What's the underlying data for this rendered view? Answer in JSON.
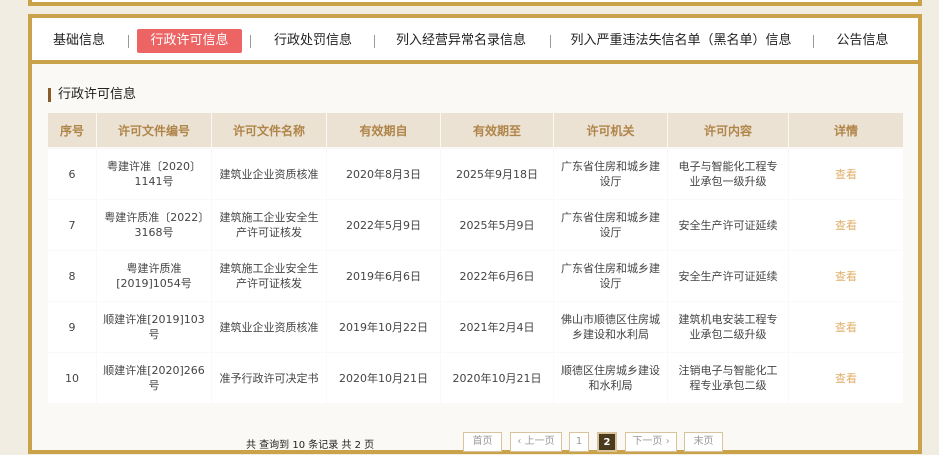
{
  "tabs": [
    {
      "label": "基础信息"
    },
    {
      "label": "行政许可信息",
      "active": true
    },
    {
      "label": "行政处罚信息"
    },
    {
      "label": "列入经营异常名录信息"
    },
    {
      "label": "列入严重违法失信名单（黑名单）信息"
    },
    {
      "label": "公告信息"
    }
  ],
  "section_title": "行政许可信息",
  "table": {
    "headers": [
      "序号",
      "许可文件编号",
      "许可文件名称",
      "有效期自",
      "有效期至",
      "许可机关",
      "许可内容",
      "详情"
    ],
    "rows": [
      [
        "6",
        "粤建许准〔2020〕1141号",
        "建筑业企业资质核准",
        "2020年8月3日",
        "2025年9月18日",
        "广东省住房和城乡建设厅",
        "电子与智能化工程专业承包一级升级",
        "查看"
      ],
      [
        "7",
        "粤建许质准〔2022〕3168号",
        "建筑施工企业安全生产许可证核发",
        "2022年5月9日",
        "2025年5月9日",
        "广东省住房和城乡建设厅",
        "安全生产许可证延续",
        "查看"
      ],
      [
        "8",
        "粤建许质准[2019]1054号",
        "建筑施工企业安全生产许可证核发",
        "2019年6月6日",
        "2022年6月6日",
        "广东省住房和城乡建设厅",
        "安全生产许可证延续",
        "查看"
      ],
      [
        "9",
        "顺建许准[2019]103号",
        "建筑业企业资质核准",
        "2019年10月22日",
        "2021年2月4日",
        "佛山市顺德区住房城乡建设和水利局",
        "建筑机电安装工程专业承包二级升级",
        "查看"
      ],
      [
        "10",
        "顺建许准[2020]266号",
        "准予行政许可决定书",
        "2020年10月21日",
        "2020年10月21日",
        "顺德区住房城乡建设和水利局",
        "注销电子与智能化工程专业承包二级",
        "查看"
      ]
    ]
  },
  "pagination": {
    "summary": "共 查询到 10 条记录 共 2 页",
    "first": "首页",
    "prev": "‹ 上一页",
    "pages": [
      "1",
      "2"
    ],
    "current": "2",
    "next": "下一页 ›",
    "last": "末页"
  },
  "colors": {
    "accent_border": "#c9a24a",
    "active_tab": "#ec6464",
    "header_bg": "#ebe2d3",
    "header_text": "#b0854a",
    "link": "#e0b06a",
    "section_marker": "#8a5a2b"
  }
}
